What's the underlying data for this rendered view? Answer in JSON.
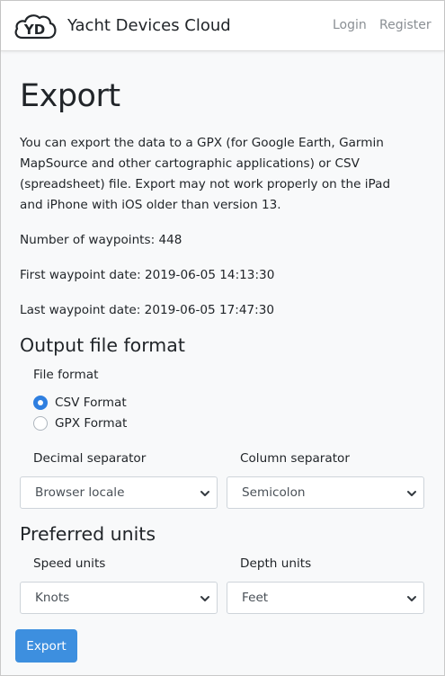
{
  "nav": {
    "logo_text": "YD",
    "brand": "Yacht Devices Cloud",
    "login": "Login",
    "register": "Register"
  },
  "page": {
    "title": "Export",
    "intro": "You can export the data to a GPX (for Google Earth, Garmin MapSource and other cartographic applications) or CSV (spreadsheet) file. Export may not work properly on the iPad and iPhone with iOS older than version 13.",
    "waypoints": "Number of waypoints: 448",
    "first_date": "First waypoint date: 2019-06-05 14:13:30",
    "last_date": "Last waypoint date: 2019-06-05 17:47:30"
  },
  "output": {
    "heading": "Output file format",
    "file_format_label": "File format",
    "options": [
      {
        "label": "CSV Format",
        "checked": true
      },
      {
        "label": "GPX Format",
        "checked": false
      }
    ],
    "decimal_label": "Decimal separator",
    "decimal_value": "Browser locale",
    "column_label": "Column separator",
    "column_value": "Semicolon"
  },
  "units": {
    "heading": "Preferred units",
    "speed_label": "Speed units",
    "speed_value": "Knots",
    "depth_label": "Depth units",
    "depth_value": "Feet"
  },
  "actions": {
    "export": "Export"
  },
  "colors": {
    "accent": "#3d8fdf",
    "radio_checked": "#2f7fe0"
  }
}
